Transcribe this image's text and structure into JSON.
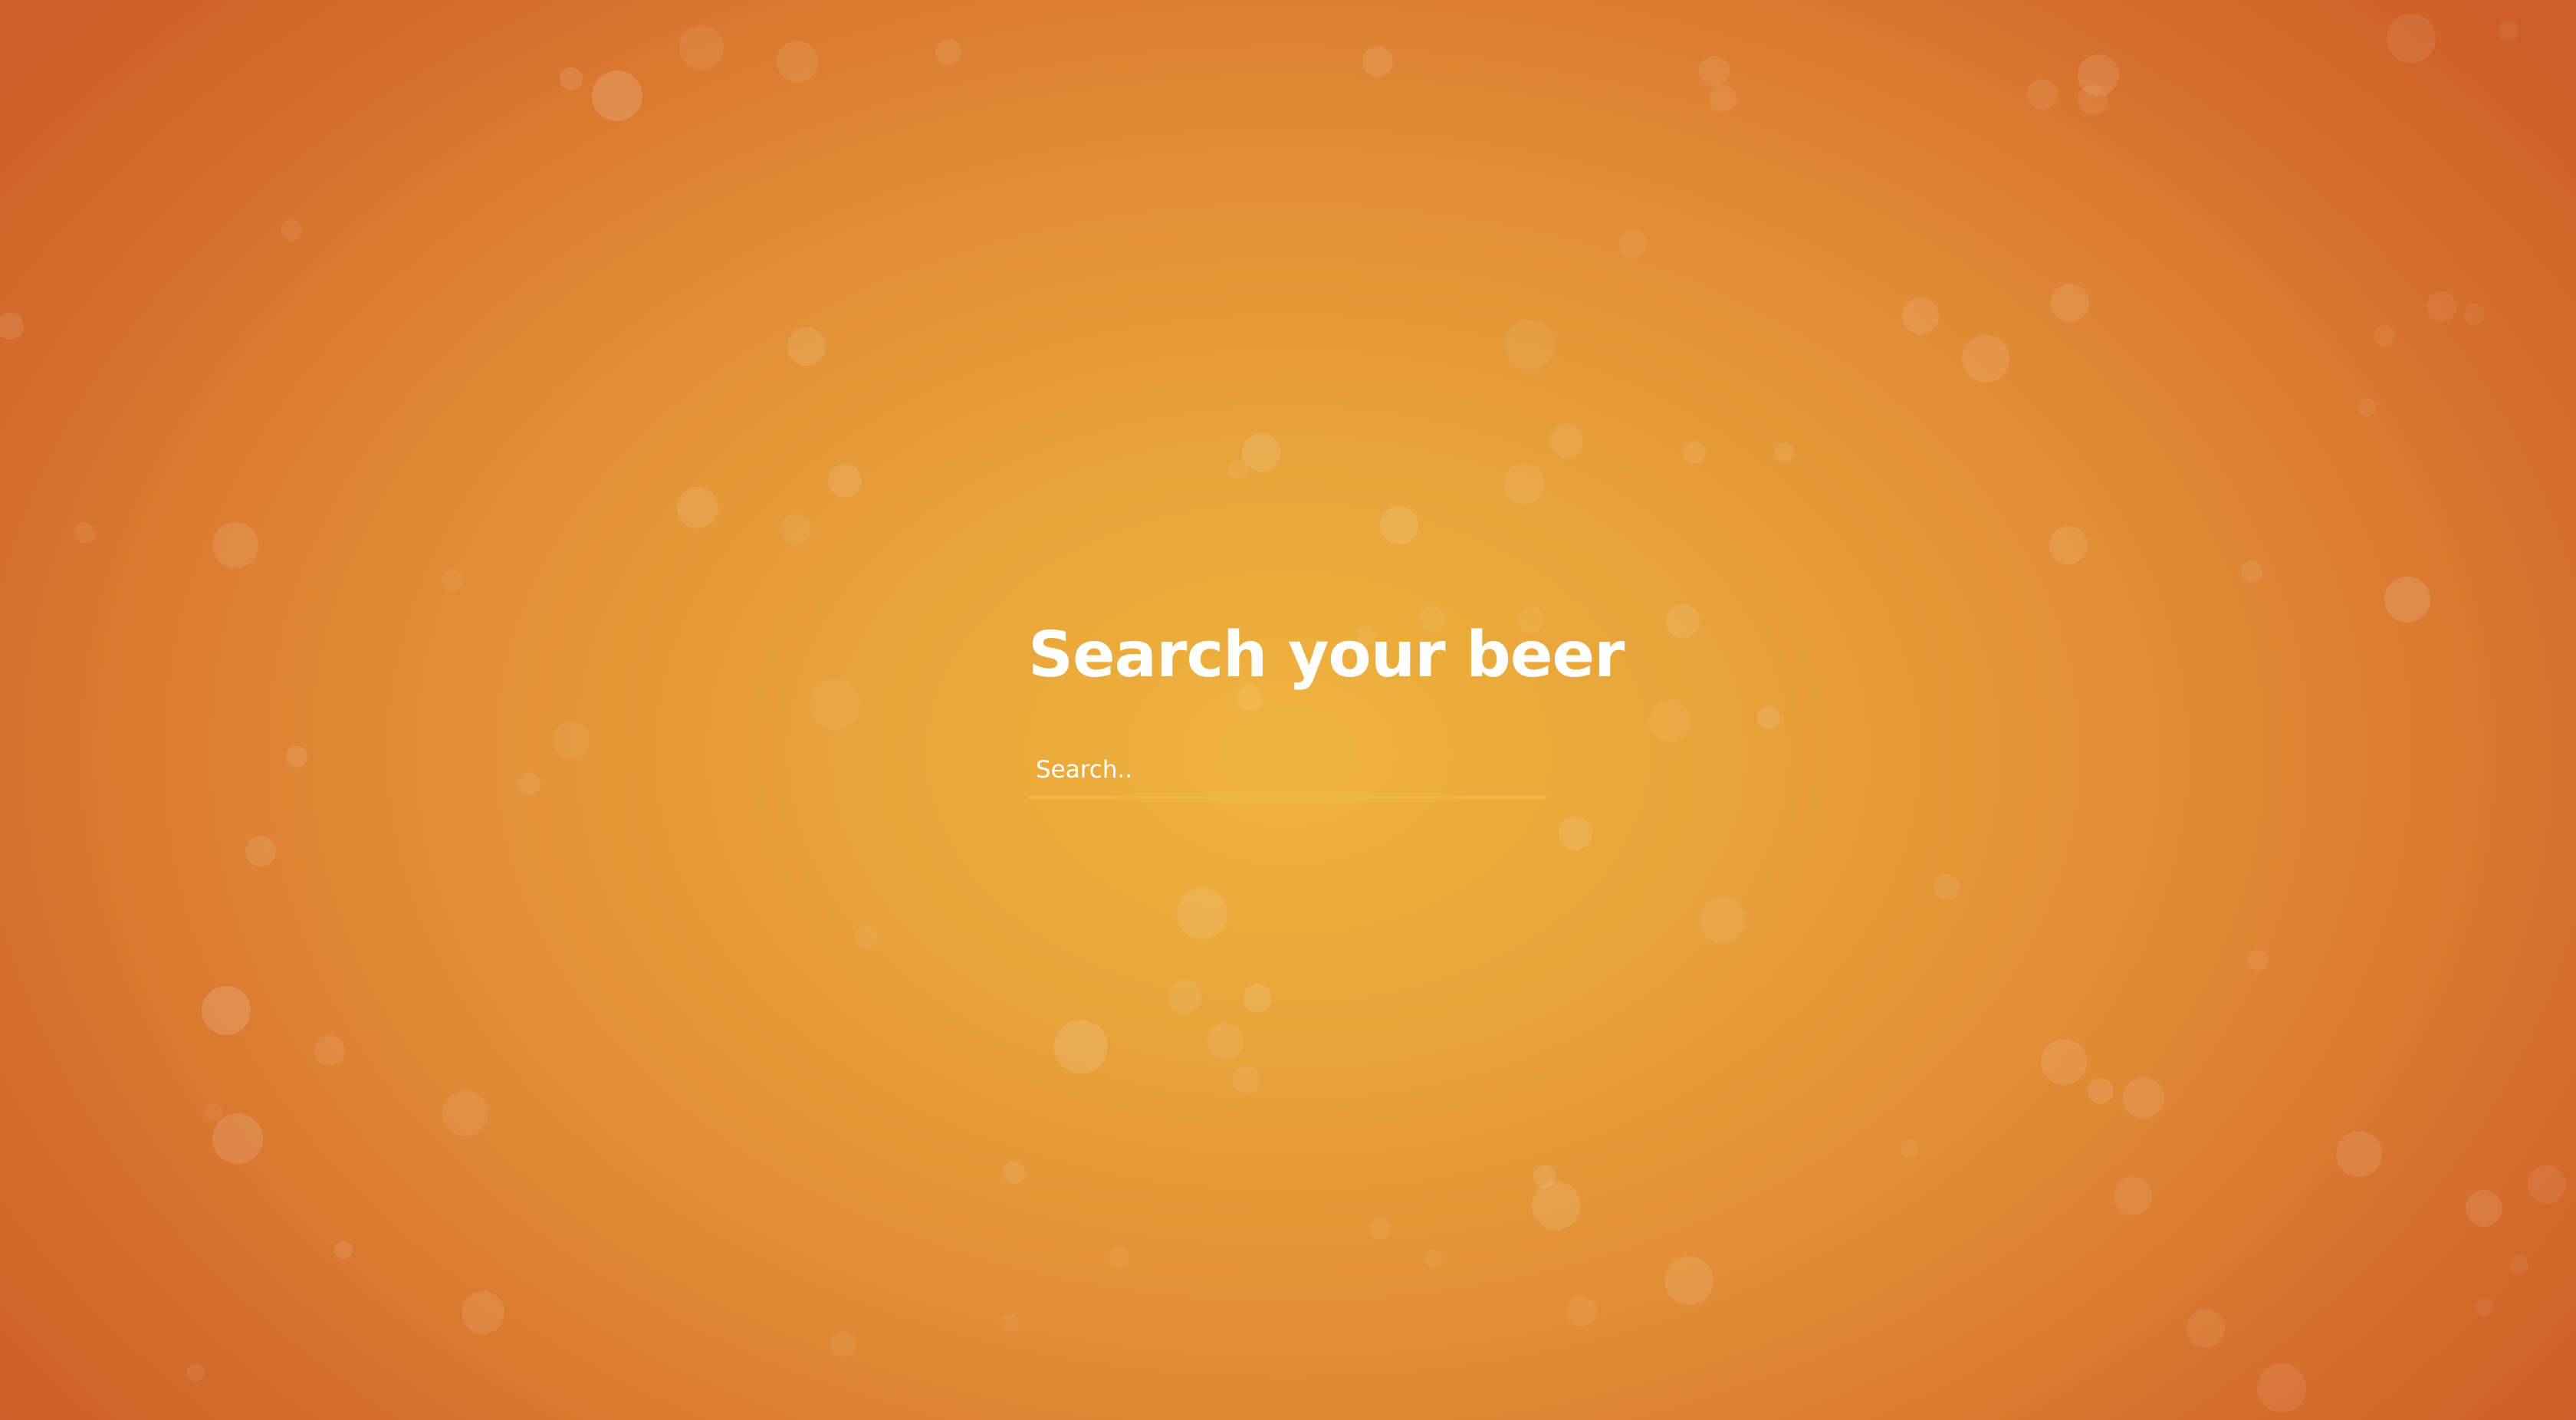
{
  "page": {
    "title": "Search your beer"
  },
  "search": {
    "placeholder": "Search..",
    "value": ""
  },
  "colors": {
    "background_center": "#efb43f",
    "background_edge": "#cf5f28",
    "text": "#ffffff",
    "input_underline": "#f0b83e"
  },
  "decoration": {
    "background": "beer-bubbles"
  }
}
